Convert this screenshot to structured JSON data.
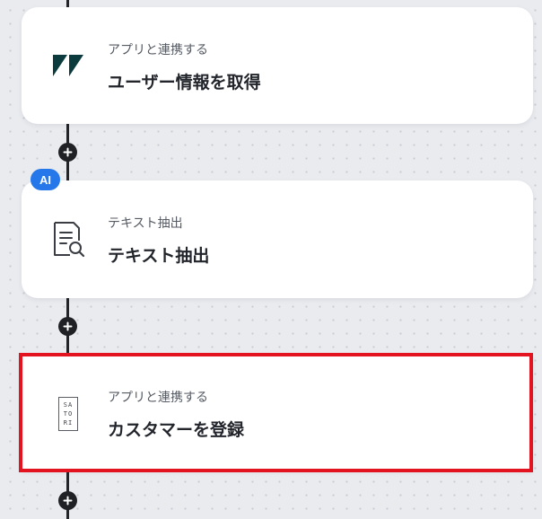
{
  "flow": {
    "steps": [
      {
        "subtitle": "アプリと連携する",
        "title": "ユーザー情報を取得",
        "icon": "zendesk-logo-icon"
      },
      {
        "badge": "AI",
        "subtitle": "テキスト抽出",
        "title": "テキスト抽出",
        "icon": "document-search-icon"
      },
      {
        "subtitle": "アプリと連携する",
        "title": "カスタマーを登録",
        "icon": "satori-logo-icon",
        "logo_text": [
          "SA",
          "TO",
          "RI"
        ],
        "selected": true
      }
    ],
    "add_button_icon": "plus-icon"
  },
  "colors": {
    "canvas_background": "#e9ebef",
    "card_background": "#ffffff",
    "connector_line": "#222428",
    "ai_badge": "#2577ea",
    "selection_outline": "#e3141f",
    "zendesk_logo": "#0b3b3c"
  }
}
